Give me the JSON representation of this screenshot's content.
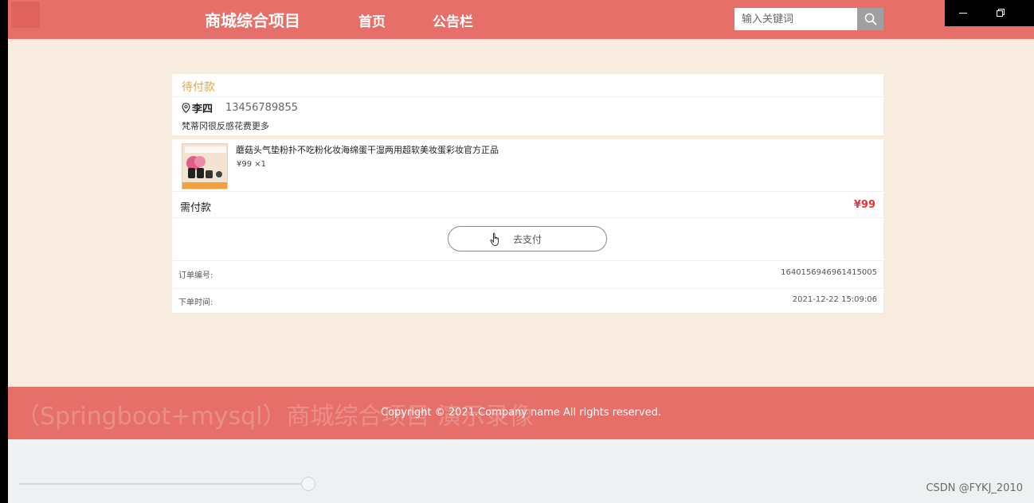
{
  "header": {
    "brand": "商城综合项目",
    "nav": {
      "home": "首页",
      "notice": "公告栏"
    },
    "search": {
      "placeholder": "输入关键词"
    }
  },
  "order": {
    "status": "待付款",
    "recipient": {
      "name": "李四",
      "phone": "13456789855",
      "address": "梵蒂冈很反感花费更多"
    },
    "product": {
      "name": "蘑菇头气垫粉扑不吃粉化妆海绵蛋干湿两用超软美妆蛋彩妆官方正品",
      "price_qty": "¥99 ×1"
    },
    "need_pay_label": "需付款",
    "need_pay_amount": "¥99",
    "pay_button": "去支付",
    "order_no_label": "订单编号:",
    "order_no": "1640156946961415005",
    "order_time_label": "下单时间:",
    "order_time": "2021-12-22 15:09:06"
  },
  "footer": {
    "copyright": "Copyright © 2021.Company name All rights reserved.",
    "overlay_title": "（Springboot+mysql）商城综合项目 演示录像"
  },
  "watermark": "CSDN @FYKJ_2010",
  "colors": {
    "primary": "#e66f69",
    "page_bg": "#f8ece1",
    "status": "#e8a53b",
    "price": "#e8323a"
  },
  "icons": {
    "search": "search-icon",
    "location": "location-pin-icon",
    "cursor": "hand-cursor-icon"
  }
}
